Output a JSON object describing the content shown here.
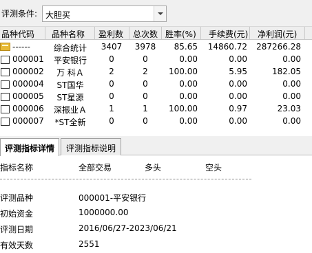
{
  "condition": {
    "label": "评测条件:",
    "selected": "大胆买"
  },
  "table": {
    "columns": [
      "品种代码",
      "品种名称",
      "盈利数",
      "总次数",
      "胜率(%)",
      "手续费(元)",
      "净利润(元)"
    ],
    "rows": [
      {
        "icon": "summary-icon",
        "code": "------",
        "name": "综合统计",
        "wins": "3407",
        "total": "3978",
        "rate": "85.65",
        "fee": "14860.72",
        "profit": "287266.28"
      },
      {
        "icon": "checkbox",
        "code": "000001",
        "name": "平安银行",
        "wins": "0",
        "total": "0",
        "rate": "0.00",
        "fee": "0.00",
        "profit": "0.00"
      },
      {
        "icon": "checkbox",
        "code": "000002",
        "name": "万 科Ａ",
        "wins": "2",
        "total": "2",
        "rate": "100.00",
        "fee": "5.95",
        "profit": "182.05"
      },
      {
        "icon": "checkbox",
        "code": "000004",
        "name": "ST国华",
        "wins": "0",
        "total": "0",
        "rate": "0.00",
        "fee": "0.00",
        "profit": "0.00"
      },
      {
        "icon": "checkbox",
        "code": "000005",
        "name": "ST星源",
        "wins": "0",
        "total": "0",
        "rate": "0.00",
        "fee": "0.00",
        "profit": "0.00"
      },
      {
        "icon": "checkbox",
        "code": "000006",
        "name": "深振业Ａ",
        "wins": "1",
        "total": "1",
        "rate": "100.00",
        "fee": "0.97",
        "profit": "23.03"
      },
      {
        "icon": "checkbox",
        "code": "000007",
        "name": "*ST全新",
        "wins": "0",
        "total": "0",
        "rate": "0.00",
        "fee": "0.00",
        "profit": "0.00"
      }
    ]
  },
  "tabs": [
    {
      "label": "评测指标详情",
      "active": true
    },
    {
      "label": "评测指标说明",
      "active": false
    }
  ],
  "detail": {
    "headers": [
      "指标名称",
      "全部交易",
      "多头",
      "空头"
    ],
    "rows": [
      {
        "label": "评测品种",
        "value": "000001-平安银行"
      },
      {
        "label": "初始资金",
        "value": "1000000.00"
      },
      {
        "label": "评测日期",
        "value": "2016/06/27-2023/06/21"
      },
      {
        "label": "有效天数",
        "value": "2551"
      }
    ]
  }
}
